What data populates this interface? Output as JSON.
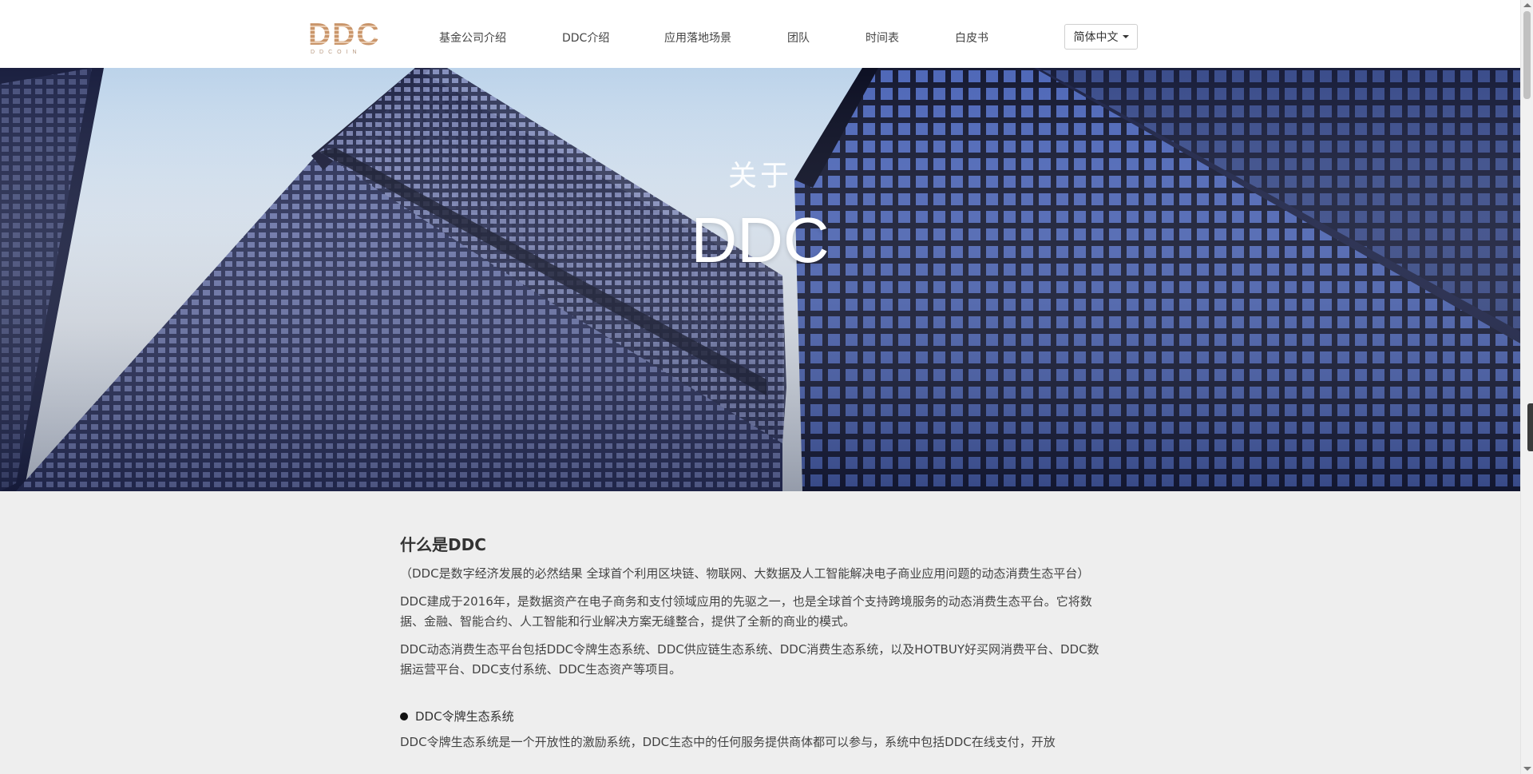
{
  "brand": {
    "logo_text": "DDC",
    "logo_subtext": "DDCOIN",
    "logo_color": "#c9956a"
  },
  "nav": {
    "items": [
      "基金公司介绍",
      "DDC介绍",
      "应用落地场景",
      "团队",
      "时间表",
      "白皮书"
    ]
  },
  "language": {
    "selected": "简体中文"
  },
  "hero": {
    "pretitle": "关于",
    "title": "DDC"
  },
  "content": {
    "section_title": "什么是DDC",
    "paragraphs": [
      "（DDC是数字经济发展的必然结果 全球首个利用区块链、物联网、大数据及人工智能解决电子商业应用问题的动态消费生态平台）",
      "DDC建成于2016年，是数据资产在电子商务和支付领域应用的先驱之一，也是全球首个支持跨境服务的动态消费生态平台。它将数据、金融、智能合约、人工智能和行业解决方案无缝整合，提供了全新的商业的模式。",
      "DDC动态消费生态平台包括DDC令牌生态系统、DDC供应链生态系统、DDC消费生态系统，以及HOTBUY好买网消费平台、DDC数据运营平台、DDC支付系统、DDC生态资产等项目。"
    ],
    "bullet_title": "DDC令牌生态系统",
    "bullet_text_cut": "DDC令牌生态系统是一个开放性的激励系统，DDC生态中的任何服务提供商体都可以参与，系统中包括DDC在线支付，开放"
  }
}
